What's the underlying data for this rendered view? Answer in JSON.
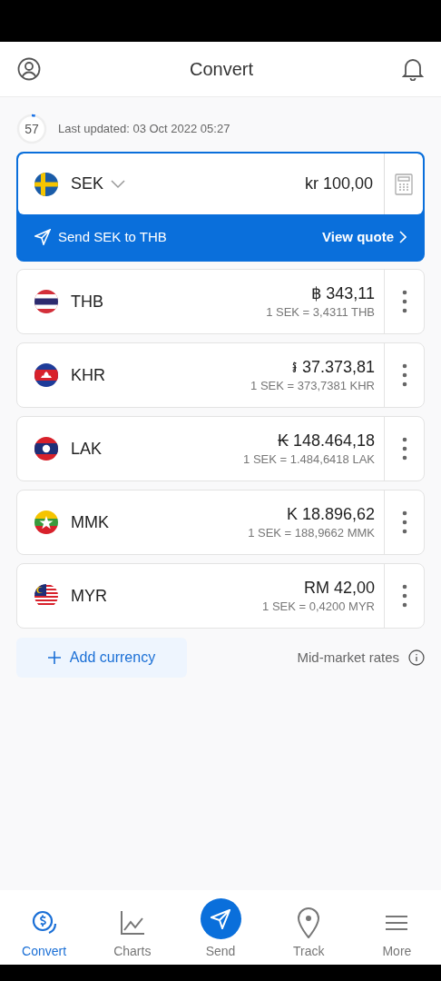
{
  "header": {
    "title": "Convert"
  },
  "update": {
    "countdown": "57",
    "level": 0.04,
    "text": "Last updated: 03 Oct 2022 05:27"
  },
  "source": {
    "code": "SEK",
    "amount": "kr 100,00",
    "send_label": "Send SEK to THB",
    "quote_label": "View quote"
  },
  "currencies": [
    {
      "code": "THB",
      "amount": "฿ 343,11",
      "rate": "1 SEK = 3,4311 THB"
    },
    {
      "code": "KHR",
      "amount": "៛ 37.373,81",
      "rate": "1 SEK = 373,7381 KHR"
    },
    {
      "code": "LAK",
      "amount": "₭ 148.464,18",
      "rate": "1 SEK = 1.484,6418 LAK"
    },
    {
      "code": "MMK",
      "amount": "K 18.896,62",
      "rate": "1 SEK = 188,9662 MMK"
    },
    {
      "code": "MYR",
      "amount": "RM 42,00",
      "rate": "1 SEK = 0,4200 MYR"
    }
  ],
  "add_currency": "Add currency",
  "rates_note": "Mid-market rates",
  "nav": [
    {
      "label": "Convert",
      "kind": "tab",
      "selected": true
    },
    {
      "label": "Charts",
      "kind": "tab",
      "selected": false
    },
    {
      "label": "Send",
      "kind": "fab",
      "selected": false
    },
    {
      "label": "Track",
      "kind": "tab",
      "selected": false
    },
    {
      "label": "More",
      "kind": "tab",
      "selected": false
    }
  ]
}
